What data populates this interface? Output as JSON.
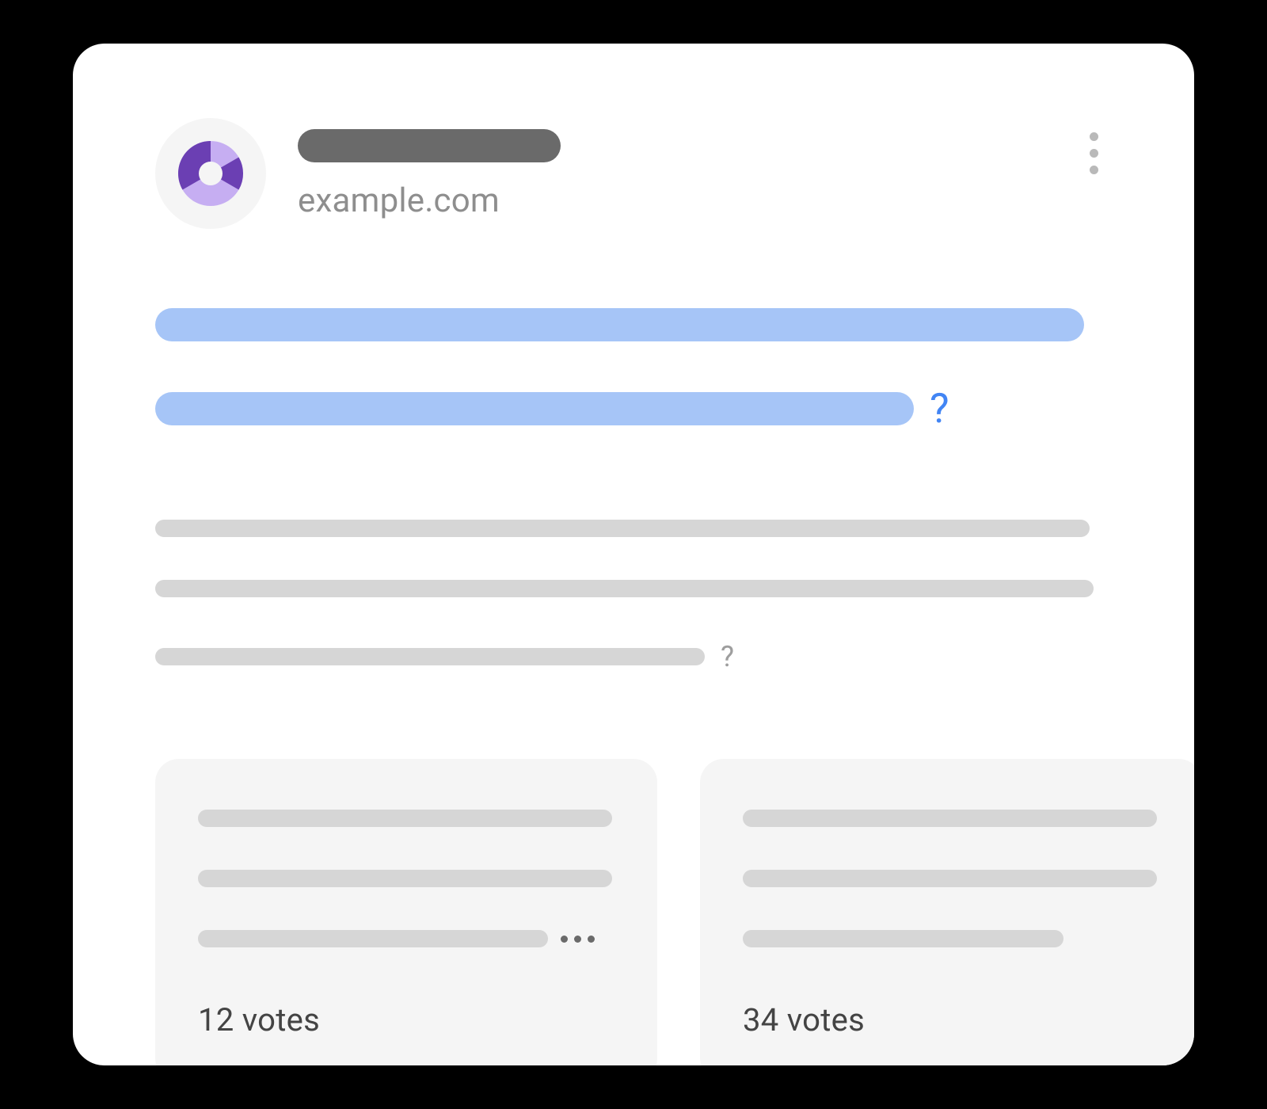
{
  "header": {
    "domain": "example.com",
    "title_question_mark": "?",
    "desc_question_mark": "?"
  },
  "answers": [
    {
      "votes_label": "12 votes"
    },
    {
      "votes_label": "34 votes"
    }
  ]
}
